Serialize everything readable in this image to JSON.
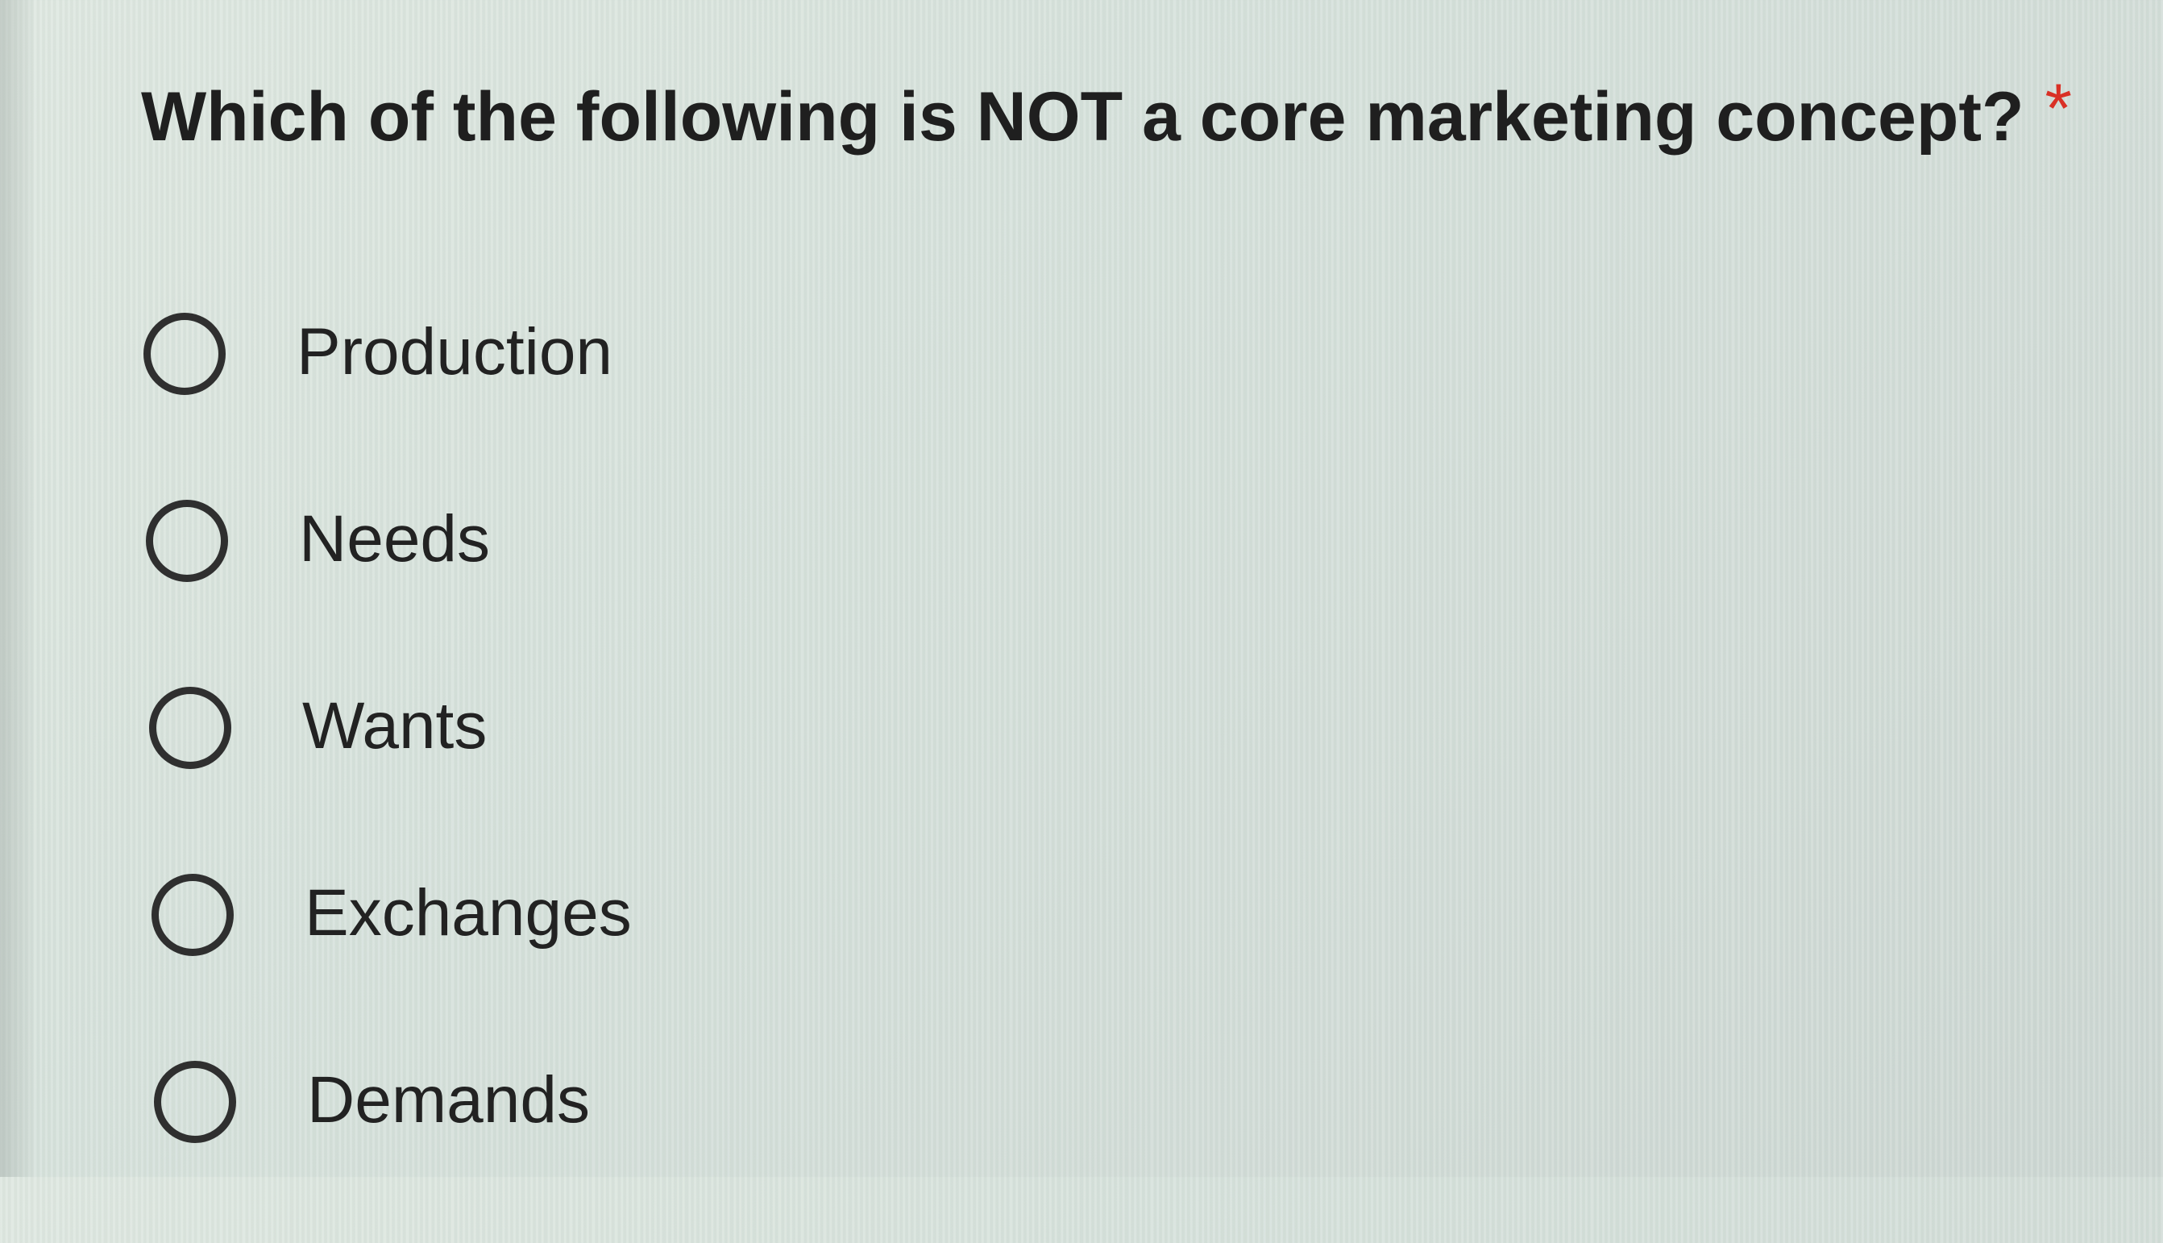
{
  "question": {
    "text": "Which of the following is NOT a core marketing concept?",
    "required_marker": "*"
  },
  "options": [
    {
      "label": "Production",
      "selected": false
    },
    {
      "label": "Needs",
      "selected": false
    },
    {
      "label": "Wants",
      "selected": false
    },
    {
      "label": "Exchanges",
      "selected": false
    },
    {
      "label": "Demands",
      "selected": false
    }
  ]
}
